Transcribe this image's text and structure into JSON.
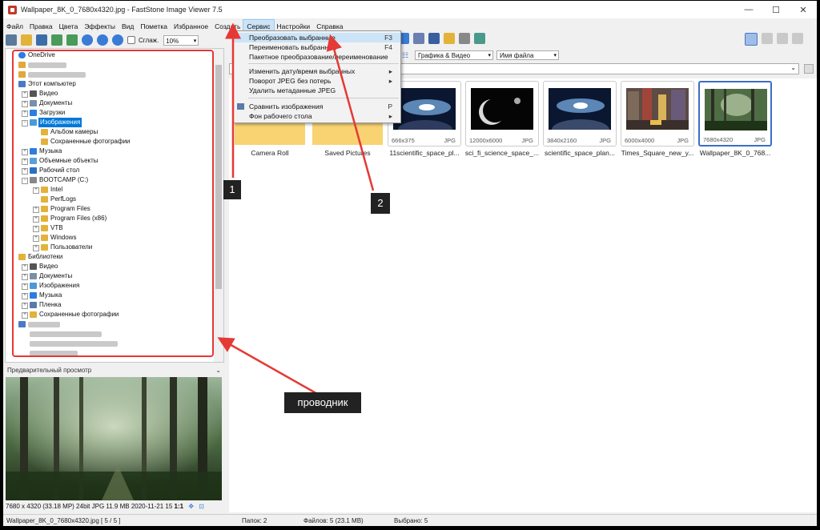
{
  "window": {
    "title": "Wallpaper_8K_0_7680x4320.jpg  -  FastStone Image Viewer 7.5",
    "minimize": "—",
    "maximize": "☐",
    "close": "✕"
  },
  "menu": [
    "Файл",
    "Правка",
    "Цвета",
    "Эффекты",
    "Вид",
    "Пометка",
    "Избранное",
    "Создать",
    "Сервис",
    "Настройки",
    "Справка"
  ],
  "toolbar": {
    "smooth_label": "Сглаж.",
    "zoom_value": "10%"
  },
  "service_menu": {
    "items": [
      {
        "label": "Преобразовать выбранные",
        "shortcut": "F3",
        "highlighted": true
      },
      {
        "label": "Переименовать выбранные",
        "shortcut": "F4"
      },
      {
        "label": "Пакетное преобразование/переименование",
        "shortcut": ""
      },
      {
        "label": "Изменить дату/время выбранных",
        "shortcut": "▸"
      },
      {
        "label": "Поворот JPEG без потерь",
        "shortcut": "▸"
      },
      {
        "label": "Удалить метаданные JPEG",
        "shortcut": ""
      },
      {
        "label": "Сравнить изображения",
        "shortcut": "P"
      },
      {
        "label": "Фон рабочего стола",
        "shortcut": "▸"
      }
    ]
  },
  "tree": [
    {
      "label": "OneDrive"
    },
    {
      "label": "Этот компьютер"
    },
    {
      "label": "Видео"
    },
    {
      "label": "Документы"
    },
    {
      "label": "Загрузки"
    },
    {
      "label": "Изображения"
    },
    {
      "label": "Альбом камеры"
    },
    {
      "label": "Сохраненные фотографии"
    },
    {
      "label": "Музыка"
    },
    {
      "label": "Объемные объекты"
    },
    {
      "label": "Рабочий стол"
    },
    {
      "label": "BOOTCAMP (C:)"
    },
    {
      "label": "Intel"
    },
    {
      "label": "PerfLogs"
    },
    {
      "label": "Program Files"
    },
    {
      "label": "Program Files (x86)"
    },
    {
      "label": "VTB"
    },
    {
      "label": "Windows"
    },
    {
      "label": "Пользователи"
    },
    {
      "label": "Библиотеки"
    },
    {
      "label": "Видео"
    },
    {
      "label": "Документы"
    },
    {
      "label": "Изображения"
    },
    {
      "label": "Музыка"
    },
    {
      "label": "Пленка"
    },
    {
      "label": "Сохраненные фотографии"
    }
  ],
  "preview": {
    "header": "Предварительный просмотр",
    "info": "7680 x 4320 (33.18 MP)  24bit  JPG   11.9 MB    2020-11-21 15",
    "ratio": "1:1"
  },
  "filter": {
    "type": "Графика & Видео",
    "sort": "Имя файла"
  },
  "folders": [
    {
      "name": "Camera Roll"
    },
    {
      "name": "Saved Pictures"
    }
  ],
  "thumbnails": [
    {
      "name": "11scientific_space_pl...",
      "resolution": "666x375",
      "format": "JPG"
    },
    {
      "name": "sci_fi_science_space_...",
      "resolution": "12000x6000",
      "format": "JPG"
    },
    {
      "name": "scientific_space_plan...",
      "resolution": "3840x2160",
      "format": "JPG"
    },
    {
      "name": "Times_Square_new_y...",
      "resolution": "6000x4000",
      "format": "JPG"
    },
    {
      "name": "Wallpaper_8K_0_768...",
      "resolution": "7680x4320",
      "format": "JPG"
    }
  ],
  "status": {
    "file": "Wallpaper_8K_0_7680x4320.jpg  [ 5 / 5 ]",
    "folders": "Папок: 2",
    "files": "Файлов: 5 (23.1 MB)",
    "selected": "Выбрано: 5"
  },
  "annotations": {
    "label1": "1",
    "label2": "2",
    "explorer": "проводник"
  }
}
